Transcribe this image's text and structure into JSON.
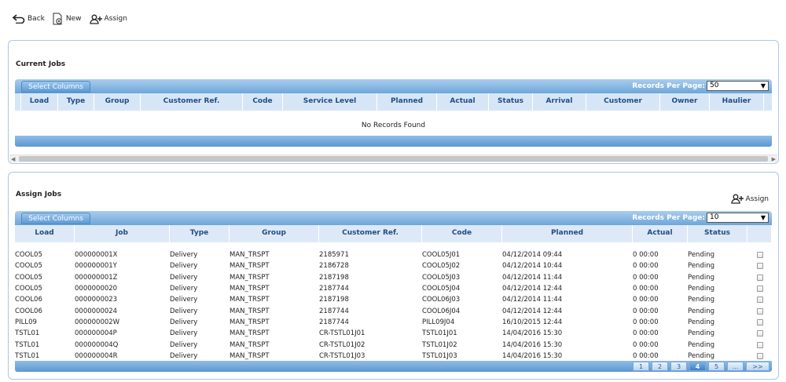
{
  "toolbar": {
    "back": "Back",
    "new": "New",
    "assign": "Assign"
  },
  "current_jobs": {
    "title": "Current Jobs",
    "select_columns": "Select Columns",
    "records_per_page_label": "Records Per Page:",
    "records_per_page_value": "50",
    "columns": [
      "Load",
      "Type",
      "Group",
      "Customer Ref.",
      "Code",
      "Service Level",
      "Planned",
      "Actual",
      "Status",
      "Arrival",
      "Customer",
      "Owner",
      "Haulier"
    ],
    "no_records": "No Records Found"
  },
  "assign_jobs": {
    "title": "Assign Jobs",
    "assign_button": "Assign",
    "select_columns": "Select Columns",
    "records_per_page_label": "Records Per Page:",
    "records_per_page_value": "10",
    "columns": [
      "Load",
      "Job",
      "Type",
      "Group",
      "Customer Ref.",
      "Code",
      "Planned",
      "Actual",
      "Status"
    ],
    "rows": [
      [
        "COOL05",
        "000000001X",
        "Delivery",
        "MAN_TRSPT",
        "2185971",
        "COOL05J01",
        "04/12/2014 09:44",
        "0 00:00",
        "Pending"
      ],
      [
        "COOL05",
        "000000001Y",
        "Delivery",
        "MAN_TRSPT",
        "2186728",
        "COOL05J02",
        "04/12/2014 10:44",
        "0 00:00",
        "Pending"
      ],
      [
        "COOL05",
        "000000001Z",
        "Delivery",
        "MAN_TRSPT",
        "2187198",
        "COOL05J03",
        "04/12/2014 11:44",
        "0 00:00",
        "Pending"
      ],
      [
        "COOL05",
        "0000000020",
        "Delivery",
        "MAN_TRSPT",
        "2187744",
        "COOL05J04",
        "04/12/2014 12:44",
        "0 00:00",
        "Pending"
      ],
      [
        "COOL06",
        "0000000023",
        "Delivery",
        "MAN_TRSPT",
        "2187198",
        "COOL06J03",
        "04/12/2014 11:44",
        "0 00:00",
        "Pending"
      ],
      [
        "COOL06",
        "0000000024",
        "Delivery",
        "MAN_TRSPT",
        "2187744",
        "COOL06J04",
        "04/12/2014 12:44",
        "0 00:00",
        "Pending"
      ],
      [
        "PILL09",
        "000000002W",
        "Delivery",
        "MAN_TRSPT",
        "2187744",
        "PILL09J04",
        "16/10/2015 12:44",
        "0 00:00",
        "Pending"
      ],
      [
        "TSTL01",
        "000000004P",
        "Delivery",
        "MAN_TRSPT",
        "CR-TSTL01J01",
        "TSTL01J01",
        "14/04/2016 15:30",
        "0 00:00",
        "Pending"
      ],
      [
        "TSTL01",
        "000000004Q",
        "Delivery",
        "MAN_TRSPT",
        "CR-TSTL01J02",
        "TSTL01J02",
        "14/04/2016 15:30",
        "0 00:00",
        "Pending"
      ],
      [
        "TSTL01",
        "000000004R",
        "Delivery",
        "MAN_TRSPT",
        "CR-TSTL01J03",
        "TSTL01J03",
        "14/04/2016 15:30",
        "0 00:00",
        "Pending"
      ]
    ],
    "pager": [
      "1",
      "2",
      "3",
      "4",
      "5",
      "...",
      ">>"
    ],
    "active_page": "4"
  },
  "colors": {
    "header_blue": "#6ea6d9",
    "column_header_bg": "#d7e6f6",
    "column_header_text": "#1f4d85",
    "panel_border": "#aac7e4"
  },
  "icons": {
    "back": "back-arrow-icon",
    "new": "new-document-icon",
    "assign": "assign-user-icon"
  }
}
